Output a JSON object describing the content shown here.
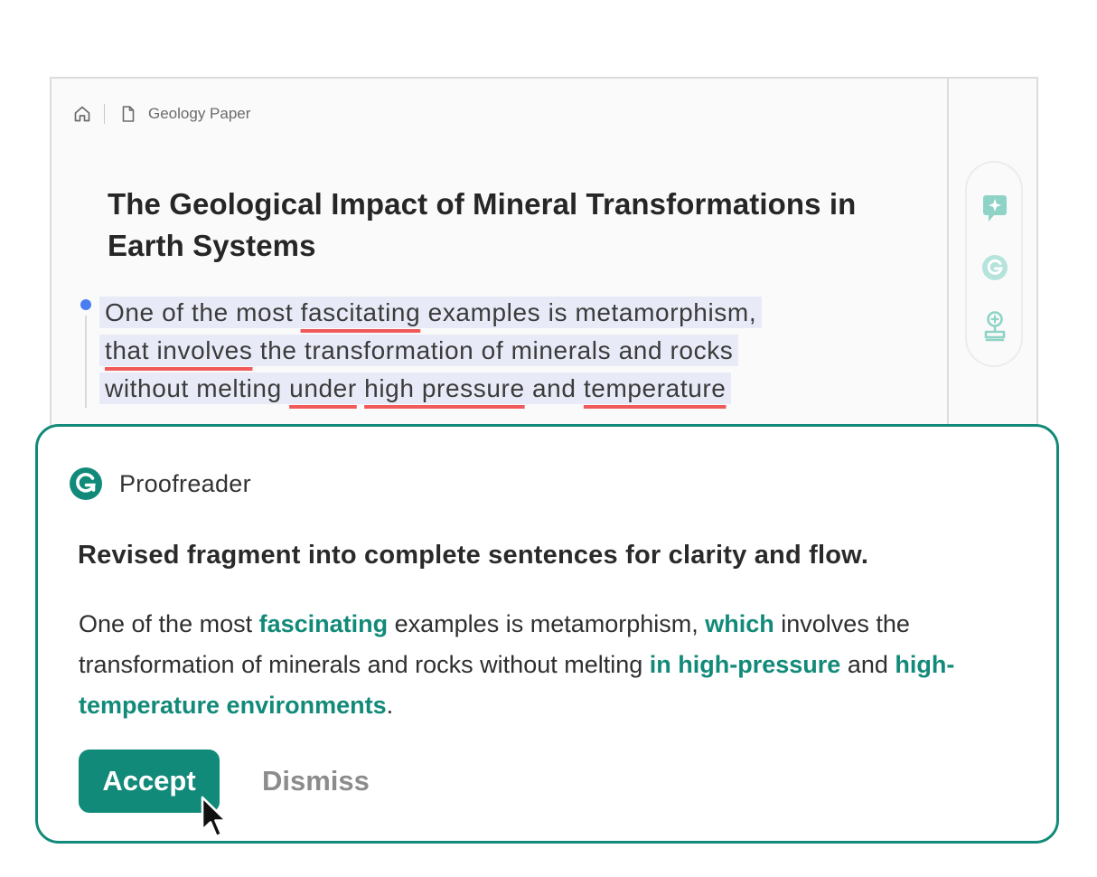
{
  "document": {
    "breadcrumb": {
      "home_icon": "home-icon",
      "file_icon": "document-icon",
      "title": "Geology Paper"
    },
    "title": "The Geological Impact of Mineral Transformations in Earth Systems",
    "paragraph": {
      "line1": {
        "p1": "One of the most ",
        "e1": "fascitating",
        "p2": " examples is metamorphism,"
      },
      "line2": {
        "e1": "that involves",
        "p1": " the transformation of minerals and rocks"
      },
      "line3": {
        "p1": "without melting ",
        "e1": "under",
        "p2": " ",
        "e2": "high pressure",
        "p3": " and ",
        "e3": "temperature"
      }
    },
    "side_rail": {
      "icons": [
        "sparkle-chat-icon",
        "grammarly-icon",
        "stamp-icon"
      ]
    }
  },
  "suggestion_card": {
    "app_name": "Proofreader",
    "app_icon": "grammarly-logo-icon",
    "heading": "Revised fragment into complete sentences for clarity and flow.",
    "body": {
      "t1": "One of the most ",
      "f1": "fascinating",
      "t2": " examples is metamorphism, ",
      "f2": "which",
      "t3": " involves the transformation of minerals and rocks without melting ",
      "f3": "in high-pressure",
      "t4": " and ",
      "f4": "high-temperature environments",
      "t5": "."
    },
    "accept_label": "Accept",
    "dismiss_label": "Dismiss"
  },
  "colors": {
    "accent": "#128a79",
    "error_underline": "#f05a5a",
    "selection": "#e8ebf7",
    "marker": "#4a7df0"
  }
}
